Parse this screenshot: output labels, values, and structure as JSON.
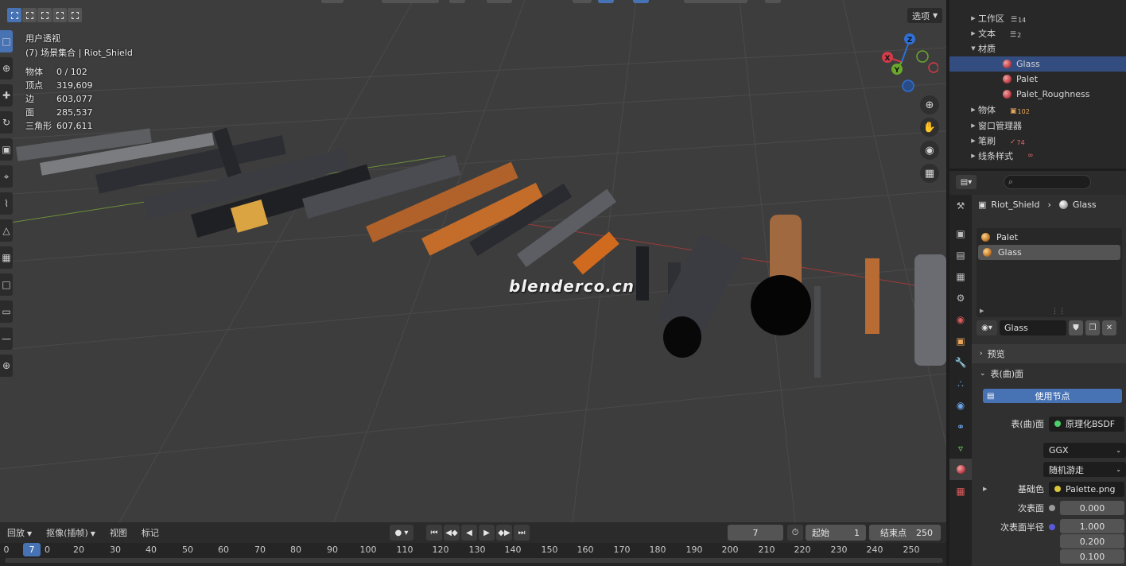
{
  "viewport": {
    "options_label": "选项",
    "view_name": "用户透视",
    "collection_line": "(7) 场景集合 | Riot_Shield",
    "stats": [
      {
        "label": "物体",
        "value": "0 / 102"
      },
      {
        "label": "顶点",
        "value": "319,609"
      },
      {
        "label": "边",
        "value": "603,077"
      },
      {
        "label": "面",
        "value": "285,537"
      },
      {
        "label": "三角形",
        "value": "607,611"
      }
    ],
    "watermark": "blenderco.cn",
    "gizmo_axes": {
      "x": "X",
      "y": "Y",
      "z": "Z"
    }
  },
  "timeline": {
    "menus": [
      {
        "label": "回放",
        "has_dropdown": true
      },
      {
        "label": "抠像(插帧)",
        "has_dropdown": true
      },
      {
        "label": "视图",
        "has_dropdown": false
      },
      {
        "label": "标记",
        "has_dropdown": false
      }
    ],
    "current_frame": "7",
    "start_label": "起始",
    "start_value": "1",
    "end_label": "结束点",
    "end_value": "250",
    "ruler_ticks": [
      "0",
      "7",
      "20",
      "30",
      "40",
      "50",
      "60",
      "70",
      "80",
      "90",
      "100",
      "110",
      "120",
      "130",
      "140",
      "150",
      "160",
      "170",
      "180",
      "190",
      "200",
      "210",
      "220",
      "230",
      "240",
      "250"
    ],
    "ruler_partial": "0"
  },
  "outliner": {
    "rows": [
      {
        "label": "工作区",
        "badge": "14",
        "indent": 0,
        "expanded": false,
        "icon": "workspace-icon"
      },
      {
        "label": "文本",
        "badge": "2",
        "indent": 0,
        "expanded": false,
        "icon": "text-icon"
      },
      {
        "label": "材质",
        "badge": "",
        "indent": 0,
        "expanded": true,
        "icon": ""
      },
      {
        "label": "Glass",
        "badge": "",
        "indent": 1,
        "expanded": false,
        "icon": "material-icon",
        "selected": true
      },
      {
        "label": "Palet",
        "badge": "",
        "indent": 1,
        "expanded": false,
        "icon": "material-icon"
      },
      {
        "label": "Palet_Roughness",
        "badge": "",
        "indent": 1,
        "expanded": false,
        "icon": "material-icon"
      },
      {
        "label": "物体",
        "badge": "102",
        "indent": 0,
        "expanded": false,
        "icon": "object-icon"
      },
      {
        "label": "窗口管理器",
        "badge": "",
        "indent": 0,
        "expanded": false,
        "icon": ""
      },
      {
        "label": "笔刷",
        "badge": "74",
        "indent": 0,
        "expanded": false,
        "icon": "brush-icon"
      },
      {
        "label": "线条样式",
        "badge": "",
        "indent": 0,
        "expanded": false,
        "icon": "linestyle-icon"
      }
    ]
  },
  "properties": {
    "breadcrumb_object": "Riot_Shield",
    "breadcrumb_material": "Glass",
    "slots": [
      "Palet",
      "Glass"
    ],
    "material_name": "Glass",
    "preview_label": "预览",
    "surface_label": "表(曲)面",
    "use_nodes_label": "使用节点",
    "surface_row_label": "表(曲)面",
    "surface_row_value": "原理化BSDF",
    "distribution": "GGX",
    "subsurface_method": "随机游走",
    "base_color_label": "基础色",
    "base_color_value": "Palette.png",
    "subsurface_label": "次表面",
    "subsurface_value": "0.000",
    "subsurface_radius_label": "次表面半径",
    "subsurface_radius_values": [
      "1.000",
      "0.200",
      "0.100"
    ]
  }
}
